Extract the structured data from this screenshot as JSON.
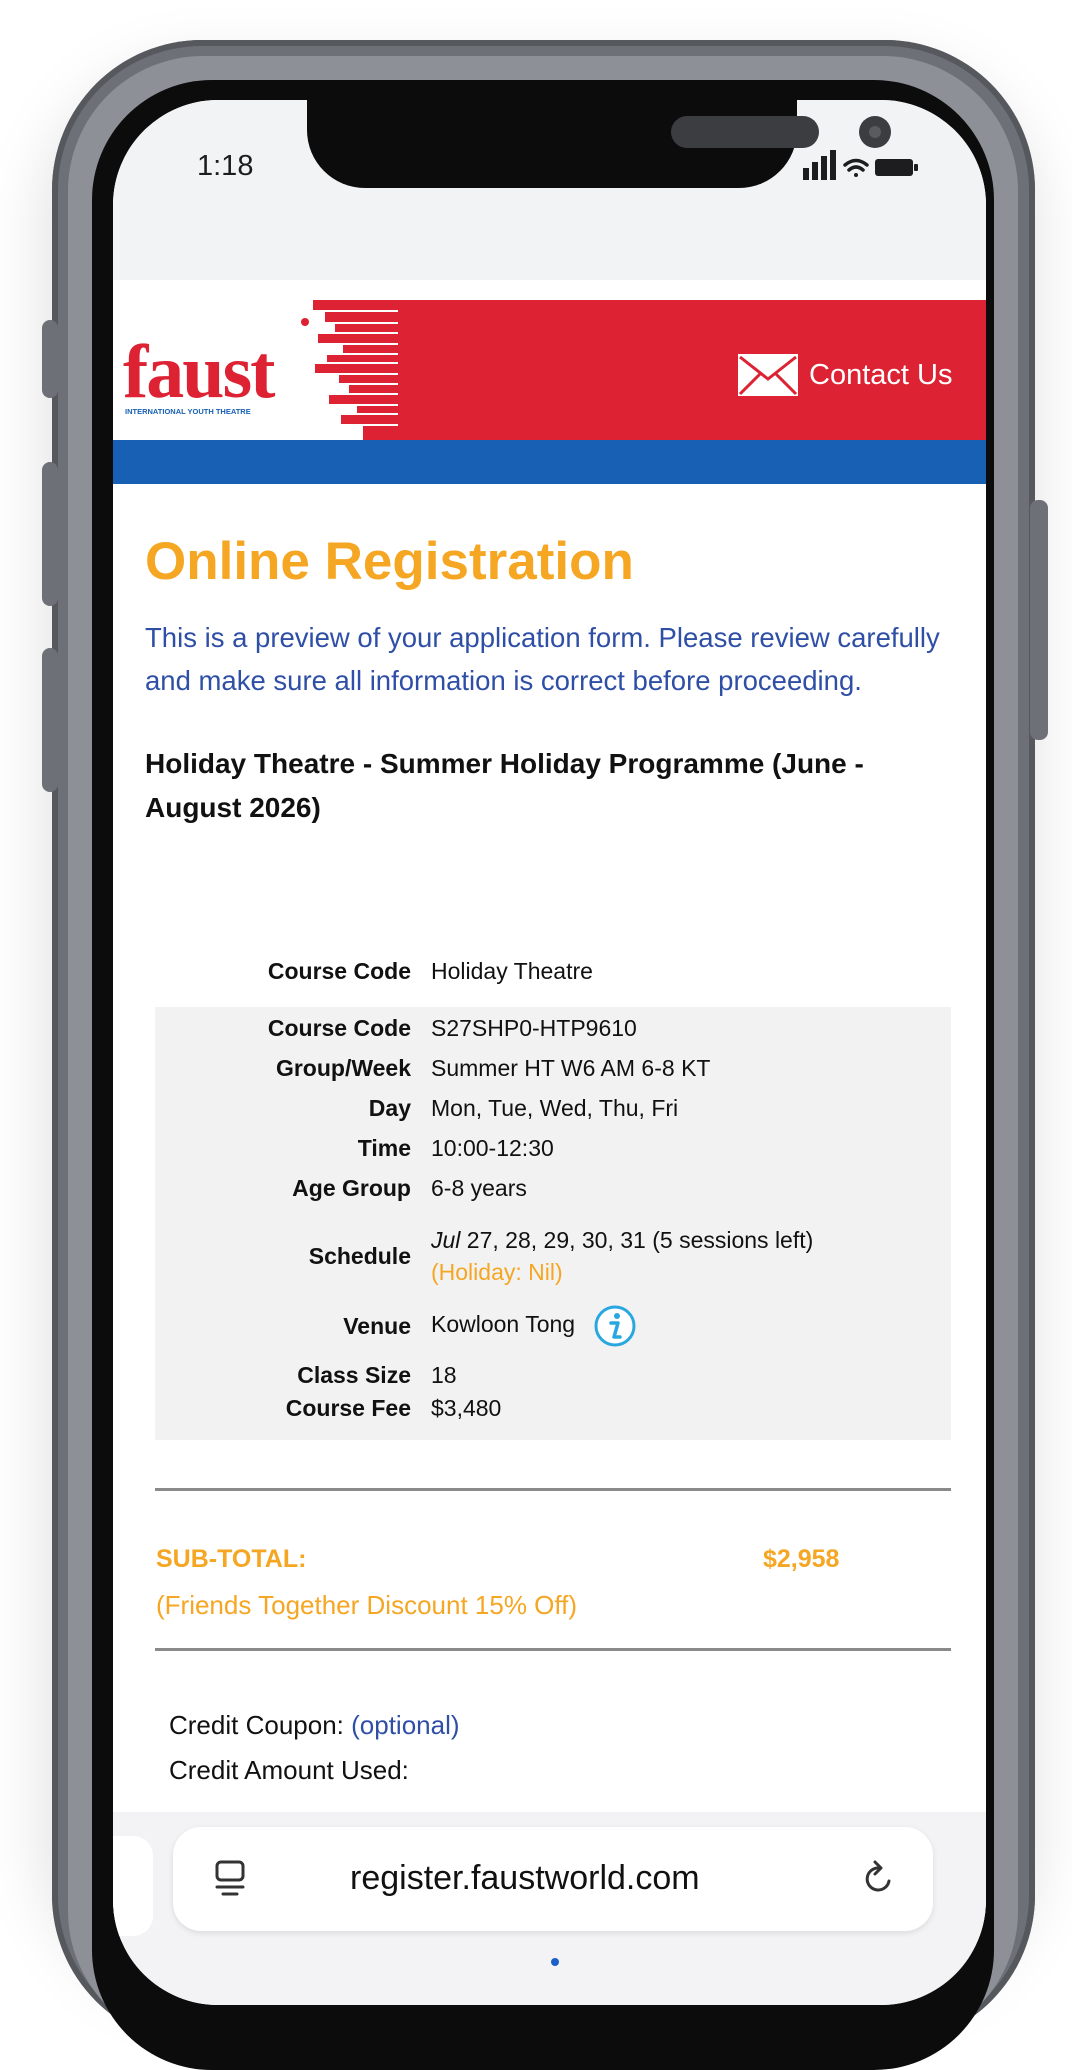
{
  "status_bar": {
    "time": "1:18"
  },
  "header": {
    "logo_text": "faust",
    "logo_subtext": "INTERNATIONAL YOUTH THEATRE",
    "contact_label": "Contact Us",
    "brand_red": "#dd2233",
    "brand_blue": "#1760b4"
  },
  "page": {
    "title": "Online Registration",
    "intro": "This is a preview of your application form. Please review carefully and make sure all information is correct before proceeding.",
    "course_title": "Holiday Theatre - Summer Holiday Programme (June - August 2026)"
  },
  "details": {
    "course_code_1": {
      "label": "Course Code",
      "value": "Holiday Theatre"
    },
    "course_code_2": {
      "label": "Course Code",
      "value": "S27SHP0-HTP9610"
    },
    "group_week": {
      "label": "Group/Week",
      "value": "Summer HT W6 AM 6-8 KT"
    },
    "day": {
      "label": "Day",
      "value": "Mon, Tue, Wed, Thu, Fri"
    },
    "time": {
      "label": "Time",
      "value": "10:00-12:30"
    },
    "age_group": {
      "label": "Age Group",
      "value": "6-8 years"
    },
    "schedule": {
      "label": "Schedule",
      "month": "Jul",
      "dates": " 27, 28, 29, 30, 31 (5 sessions left)",
      "holiday": "(Holiday: Nil)"
    },
    "venue": {
      "label": "Venue",
      "value": "Kowloon Tong"
    },
    "class_size": {
      "label": "Class Size",
      "value": "18"
    },
    "course_fee": {
      "label": "Course Fee",
      "value": "$3,480"
    }
  },
  "totals": {
    "subtotal_label": "SUB-TOTAL:",
    "subtotal_value": "$2,958",
    "discount_note": "(Friends Together Discount 15% Off)"
  },
  "credit": {
    "coupon_label": "Credit Coupon:",
    "coupon_optional": "(optional)",
    "amount_label": "Credit Amount Used:"
  },
  "browser": {
    "url": "register.faustworld.com",
    "accent_orange": "#f5a623",
    "accent_text_blue": "#2f4fa6"
  }
}
